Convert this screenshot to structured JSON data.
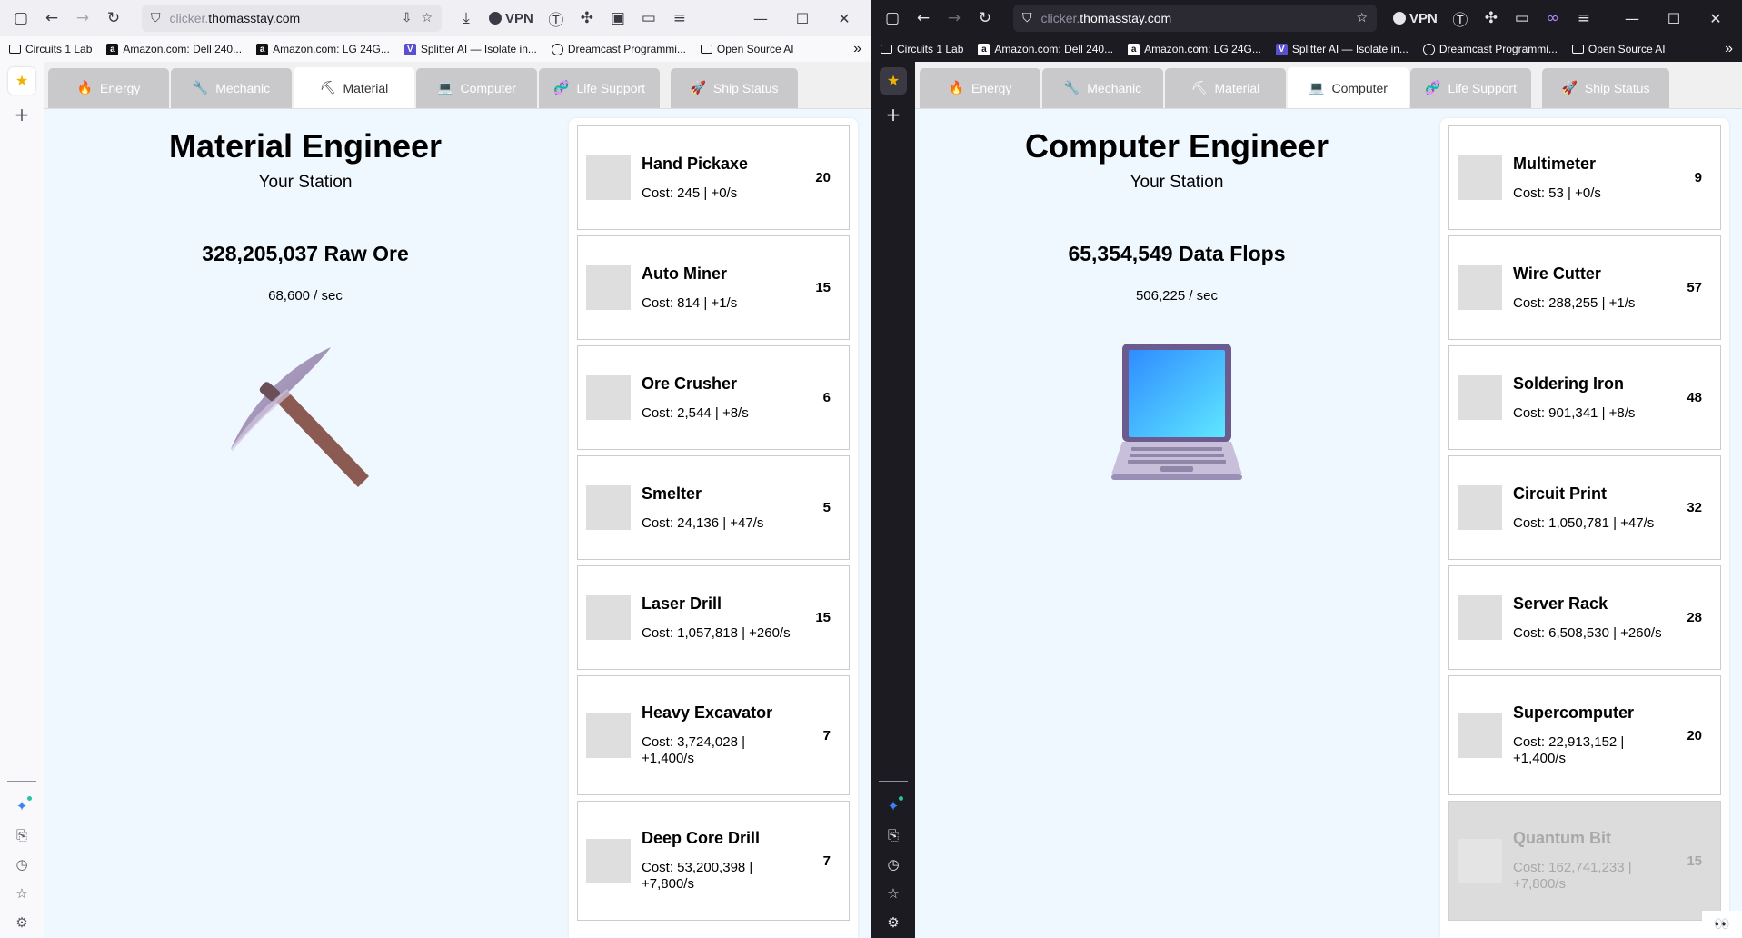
{
  "bookmarks": [
    {
      "label": "Circuits 1 Lab",
      "icon": "folder-icon"
    },
    {
      "label": "Amazon.com: Dell 240...",
      "icon": "amazon-icon"
    },
    {
      "label": "Amazon.com: LG 24G...",
      "icon": "amazon-icon"
    },
    {
      "label": "Splitter AI — Isolate in...",
      "icon": "v-icon"
    },
    {
      "label": "Dreamcast Programmi...",
      "icon": "globe-icon"
    },
    {
      "label": "Open Source AI",
      "icon": "folder-icon"
    }
  ],
  "browser": {
    "url_sub": "clicker.",
    "url_domain": "thomasstay.com",
    "vpn_label": "VPN",
    "more_label": "»"
  },
  "tabs": [
    {
      "label": "Energy",
      "icon": "🔥"
    },
    {
      "label": "Mechanic",
      "icon": "🔧"
    },
    {
      "label": "Material",
      "icon": "⛏"
    },
    {
      "label": "Computer",
      "icon": "💻"
    },
    {
      "label": "Life Support",
      "icon": "🧬"
    },
    {
      "label": "Ship Status",
      "icon": "🚀"
    }
  ],
  "left": {
    "active_tab": "Material",
    "title": "Material Engineer",
    "subtitle": "Your Station",
    "resource": "328,205,037 Raw Ore",
    "rate": "68,600 / sec",
    "art_icon": "pickaxe-icon",
    "upgrades": [
      {
        "name": "Hand Pickaxe",
        "cost": "Cost: 245 | +0/s",
        "owned": "20"
      },
      {
        "name": "Auto Miner",
        "cost": "Cost: 814 | +1/s",
        "owned": "15"
      },
      {
        "name": "Ore Crusher",
        "cost": "Cost: 2,544 | +8/s",
        "owned": "6"
      },
      {
        "name": "Smelter",
        "cost": "Cost: 24,136 | +47/s",
        "owned": "5"
      },
      {
        "name": "Laser Drill",
        "cost": "Cost: 1,057,818 | +260/s",
        "owned": "15"
      },
      {
        "name": "Heavy Excavator",
        "cost": "Cost: 3,724,028 | +1,400/s",
        "owned": "7"
      },
      {
        "name": "Deep Core Drill",
        "cost": "Cost: 53,200,398 | +7,800/s",
        "owned": "7"
      }
    ]
  },
  "right": {
    "active_tab": "Computer",
    "title": "Computer Engineer",
    "subtitle": "Your Station",
    "resource": "65,354,549 Data Flops",
    "rate": "506,225 / sec",
    "art_icon": "laptop-icon",
    "upgrades": [
      {
        "name": "Multimeter",
        "cost": "Cost: 53 | +0/s",
        "owned": "9"
      },
      {
        "name": "Wire Cutter",
        "cost": "Cost: 288,255 | +1/s",
        "owned": "57"
      },
      {
        "name": "Soldering Iron",
        "cost": "Cost: 901,341 | +8/s",
        "owned": "48"
      },
      {
        "name": "Circuit Print",
        "cost": "Cost: 1,050,781 | +47/s",
        "owned": "32"
      },
      {
        "name": "Server Rack",
        "cost": "Cost: 6,508,530 | +260/s",
        "owned": "28"
      },
      {
        "name": "Supercomputer",
        "cost": "Cost: 22,913,152 | +1,400/s",
        "owned": "20"
      },
      {
        "name": "Quantum Bit",
        "cost": "Cost: 162,741,233 | +7,800/s",
        "owned": "15",
        "locked": true
      }
    ]
  },
  "colors": {
    "page_bg": "#f0f8ff",
    "tab_inactive": "#c9c9cb",
    "locked_card": "#dcdcdc"
  }
}
